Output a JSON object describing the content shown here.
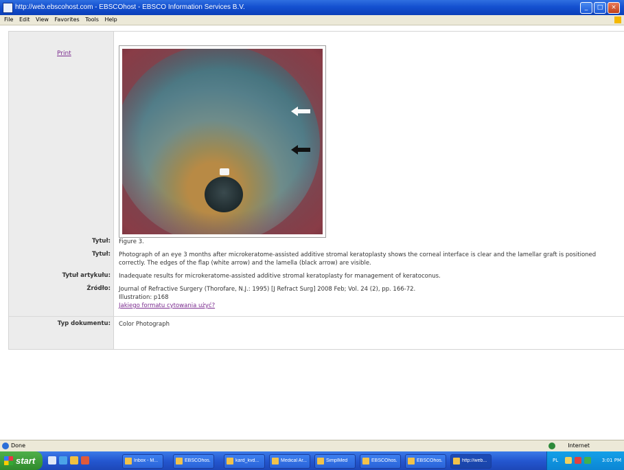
{
  "window": {
    "title": "http://web.ebscohost.com - EBSCOhost - EBSCO Information Services B.V."
  },
  "menu": [
    "File",
    "Edit",
    "View",
    "Favorites",
    "Tools",
    "Help"
  ],
  "page": {
    "print_link": "Print",
    "figure_alt": "Eye photograph",
    "fields": [
      {
        "label": "Tytuł:",
        "value": "Figure 3."
      },
      {
        "label": "Tytuł:",
        "value": "Photograph of an eye 3 months after microkeratome-assisted additive stromal keratoplasty shows the corneal interface is clear and the lamellar graft is positioned correctly. The edges of the flap (white arrow) and the lamella (black arrow) are visible."
      },
      {
        "label": "Tytuł artykułu:",
        "value": "Inadequate results for microkeratome-assisted additive stromal keratoplasty for management of keratoconus."
      },
      {
        "label": "Źródło:",
        "value": "Journal of Refractive Surgery (Thorofare, N.J.: 1995) [J Refract Surg] 2008 Feb; Vol. 24 (2), pp. 166-72.",
        "extra": "Illustration: p168",
        "link": "Jakiego formatu cytowania użyć?"
      },
      {
        "label": "Typ dokumentu:",
        "value": "Color Photograph"
      }
    ]
  },
  "status": {
    "left": "Done",
    "zone": "Internet"
  },
  "taskbar": {
    "start": "start",
    "tasks": [
      "Inbox - M...",
      "EBSCOhos...",
      "kard_kvd...",
      "Medical Ar...",
      "SimplMed",
      "EBSCOhos...",
      "EBSCOhos...",
      "http://web..."
    ],
    "active_index": 7,
    "tray_lang": "PL",
    "time": "3:01 PM"
  }
}
